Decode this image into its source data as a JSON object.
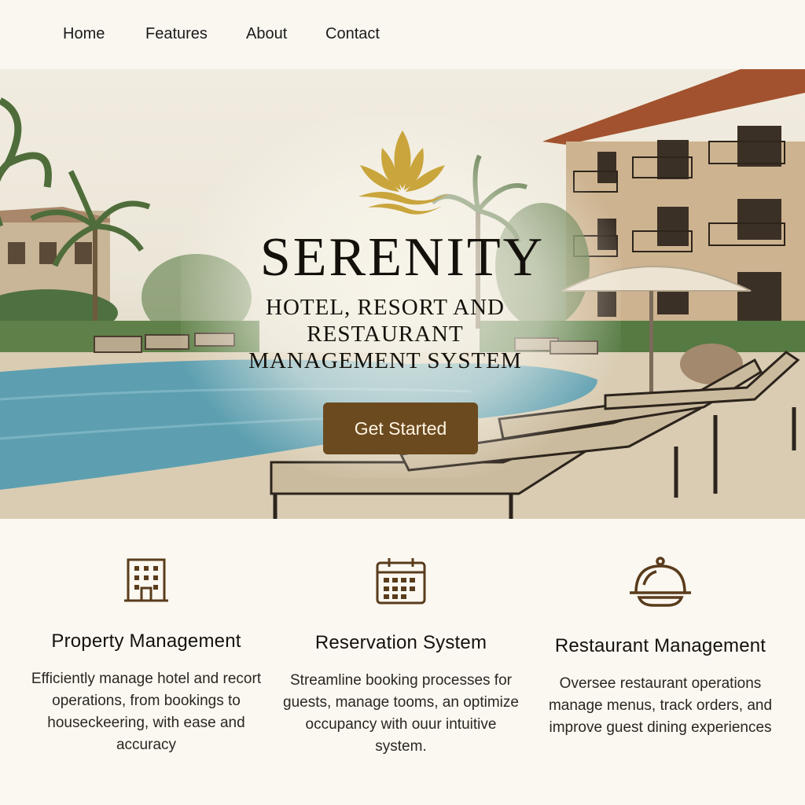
{
  "nav": {
    "home": "Home",
    "features": "Features",
    "about": "About",
    "contact": "Contact"
  },
  "hero": {
    "brand": "SERENITY",
    "subtitle_line1": "HOTEL, RESORT AND",
    "subtitle_line2": "RESTAURANT",
    "subtitle_line3": "MANAGEMENT SYSTEM",
    "cta_label": "Get Started",
    "logo_icon": "lotus-icon"
  },
  "features": [
    {
      "icon": "building-icon",
      "title": "Property Management",
      "description": "Efficiently manage hotel and recort operations, from bookings to houseckeering, with ease and accuracy"
    },
    {
      "icon": "calendar-icon",
      "title": "Reservation System",
      "description": "Streamline booking processes for guests, manage tooms, an optimize occupancy with ouur intuitive system."
    },
    {
      "icon": "cloche-icon",
      "title": "Restaurant Management",
      "description": "Oversee restaurant operations manage menus, track orders, and improve guest dining experiences"
    }
  ],
  "colors": {
    "accent": "#6b4a20",
    "gold": "#c9a53c",
    "background": "#fbf8f1",
    "icon": "#5a3c1c"
  }
}
